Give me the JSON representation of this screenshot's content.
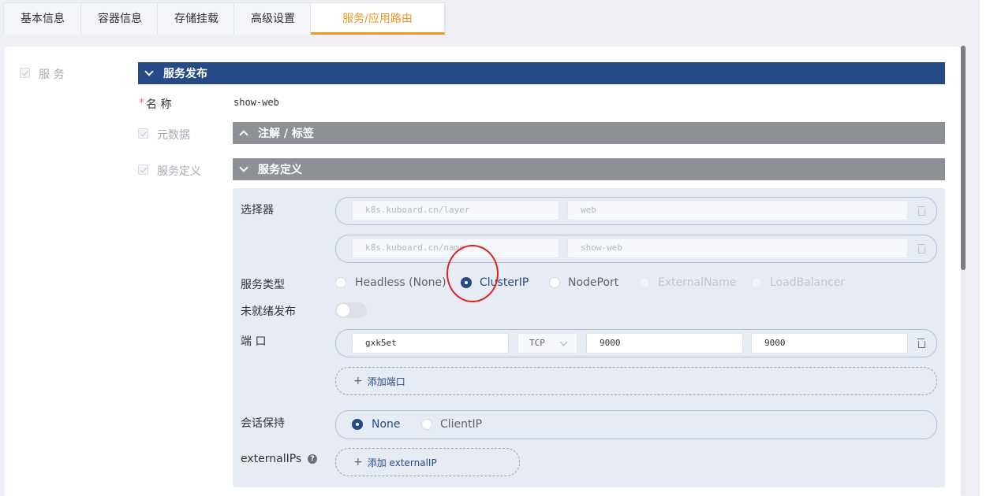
{
  "tabs": [
    {
      "label": "基本信息"
    },
    {
      "label": "容器信息"
    },
    {
      "label": "存储挂载"
    },
    {
      "label": "高级设置"
    },
    {
      "label": "服务/应用路由",
      "active": true
    }
  ],
  "left": {
    "service_checkbox_label": "服 务"
  },
  "service_publish": {
    "header": "服务发布",
    "name_required_mark": "*",
    "name_label": "名 称",
    "name_value": "show-web",
    "metadata_label": "元数据",
    "metadata_header": "注解 / 标签",
    "definition_label": "服务定义",
    "definition_header": "服务定义"
  },
  "definition": {
    "selector_label": "选择器",
    "selectors": [
      {
        "key": "k8s.kuboard.cn/layer",
        "value": "web"
      },
      {
        "key": "k8s.kuboard.cn/name",
        "value": "show-web"
      }
    ],
    "service_type_label": "服务类型",
    "service_types": [
      {
        "label": "Headless (None)",
        "state": "unchecked"
      },
      {
        "label": "ClusterIP",
        "state": "checked"
      },
      {
        "label": "NodePort",
        "state": "unchecked"
      },
      {
        "label": "ExternalName",
        "state": "disabled"
      },
      {
        "label": "LoadBalancer",
        "state": "disabled"
      }
    ],
    "unready_label": "未就绪发布",
    "unready_enabled": false,
    "port_label": "端 口",
    "ports": [
      {
        "name": "gxk5et",
        "protocol": "TCP",
        "port": "9000",
        "target_port": "9000"
      }
    ],
    "add_port_label": "添加端口",
    "session_label": "会话保持",
    "session_options": [
      {
        "label": "None",
        "state": "checked"
      },
      {
        "label": "ClientIP",
        "state": "unchecked"
      }
    ],
    "external_ips_label": "externalIPs",
    "external_ips_help": "?",
    "add_external_ip_label": "添加 externalIP"
  },
  "colors": {
    "accent": "#f39423",
    "primary": "#254a86",
    "section_gray": "#8d9196",
    "annotation_red": "#e02020"
  }
}
